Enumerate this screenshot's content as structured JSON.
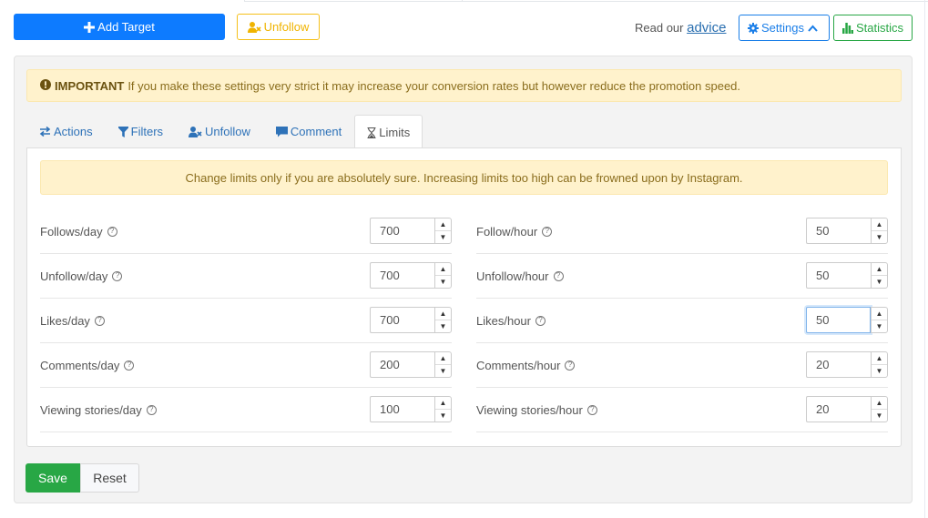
{
  "toolbar": {
    "add_target_label": "Add Target",
    "unfollow_label": "Unfollow",
    "advice_prefix": "Read our",
    "advice_link": "advice",
    "settings_label": "Settings",
    "statistics_label": "Statistics"
  },
  "alerts": {
    "important_label": "IMPORTANT",
    "important_text": "If you make these settings very strict it may increase your conversion rates but however reduce the promotion speed.",
    "limits_text": "Change limits only if you are absolutely sure. Increasing limits too high can be frowned upon by Instagram."
  },
  "tabs": [
    {
      "label": "Actions",
      "icon": "exchange-icon"
    },
    {
      "label": "Filters",
      "icon": "filter-icon"
    },
    {
      "label": "Unfollow",
      "icon": "user-times-icon"
    },
    {
      "label": "Comment",
      "icon": "comment-icon"
    },
    {
      "label": "Limits",
      "icon": "hourglass-icon",
      "active": true
    }
  ],
  "limits": {
    "left": [
      {
        "label": "Follows/day",
        "value": "700"
      },
      {
        "label": "Unfollow/day",
        "value": "700"
      },
      {
        "label": "Likes/day",
        "value": "700"
      },
      {
        "label": "Comments/day",
        "value": "200"
      },
      {
        "label": "Viewing stories/day",
        "value": "100"
      }
    ],
    "right": [
      {
        "label": "Follow/hour",
        "value": "50"
      },
      {
        "label": "Unfollow/hour",
        "value": "50"
      },
      {
        "label": "Likes/hour",
        "value": "50",
        "focused": true
      },
      {
        "label": "Comments/hour",
        "value": "20"
      },
      {
        "label": "Viewing stories/hour",
        "value": "20"
      }
    ]
  },
  "footer": {
    "save_label": "Save",
    "reset_label": "Reset"
  },
  "colors": {
    "primary": "#0d7bff",
    "warning": "#f5c01a",
    "success": "#28a745",
    "alert_bg": "#fff2cc"
  }
}
